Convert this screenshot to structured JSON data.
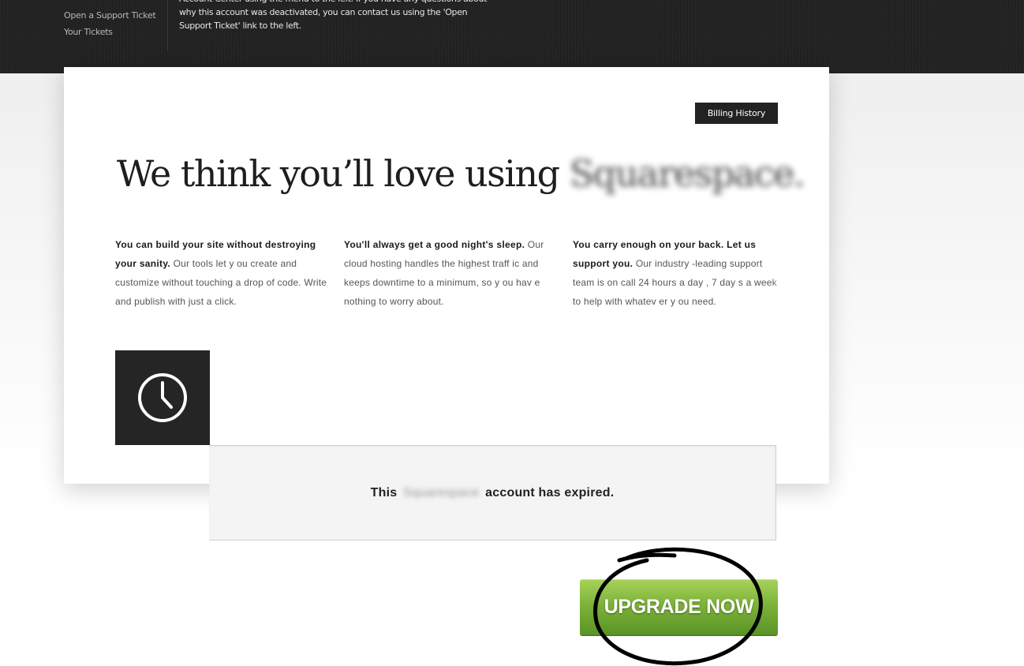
{
  "sidebar": {
    "links": [
      {
        "label": "Open a Support Ticket"
      },
      {
        "label": "Your Tickets"
      }
    ]
  },
  "notice": {
    "text": "Account Center using the menu to the left. If you have any questions about why this account was deactivated, you can contact us using the 'Open Support Ticket' link to the left."
  },
  "billing_button": "Billing History",
  "headline": {
    "prefix": "We think you’ll love using",
    "brand_blurred": "Squarespace."
  },
  "features": [
    {
      "title": "You can build your site without destroying your sanity.",
      "body": "Our tools let y ou create and customize without touching a drop of code. Write and publish with just a click."
    },
    {
      "title": "You'll always get a good night's sleep.",
      "body": "Our cloud hosting handles the highest traff ic and keeps downtime to a minimum, so y ou hav e nothing to worry  about."
    },
    {
      "title": "You carry enough on your back. Let us support you.",
      "body": "Our industry -leading support team is on call 24 hours a day , 7 day s a week to help with whatev er y ou need."
    }
  ],
  "clock_icon": "clock-icon",
  "expired": {
    "prefix": "This",
    "brand_blurred": "Squarespace",
    "suffix": "account has expired."
  },
  "upgrade_button": "UPGRADE NOW",
  "colors": {
    "topbar": "#222222",
    "button_green": "#7db33a",
    "tile_dark": "#252525"
  }
}
